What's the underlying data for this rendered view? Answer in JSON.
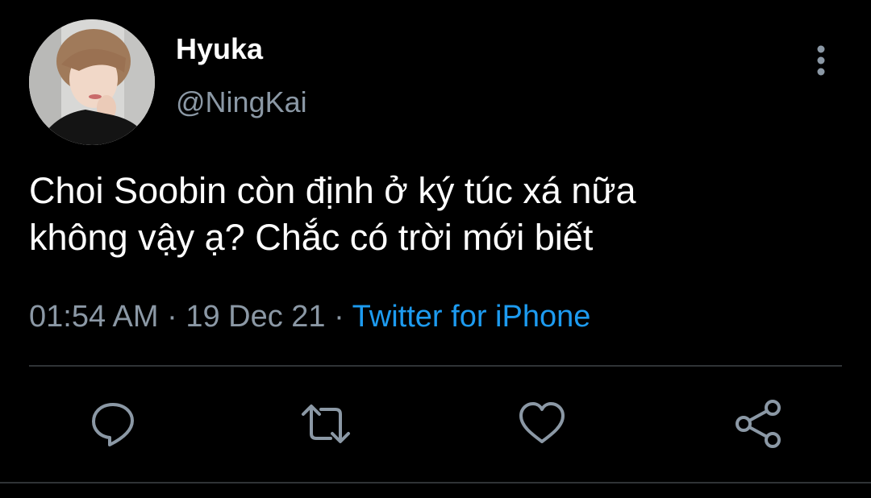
{
  "tweet": {
    "display_name": "Hyuka",
    "handle": "@NingKai",
    "text_lines": [
      "Choi Soobin còn định ở ký túc xá nữa",
      "không vậy ạ? Chắc có trời mới biết"
    ],
    "time": "01:54 AM",
    "separator": "·",
    "date": "19 Dec 21",
    "source": "Twitter for iPhone"
  },
  "icons": {
    "more": "more-vertical-icon",
    "reply": "reply-icon",
    "retweet": "retweet-icon",
    "like": "heart-icon",
    "share": "share-icon"
  },
  "colors": {
    "background": "#000000",
    "text_primary": "#ffffff",
    "text_secondary": "#8b98a5",
    "accent": "#1d9bf0",
    "divider": "#2f3336"
  }
}
